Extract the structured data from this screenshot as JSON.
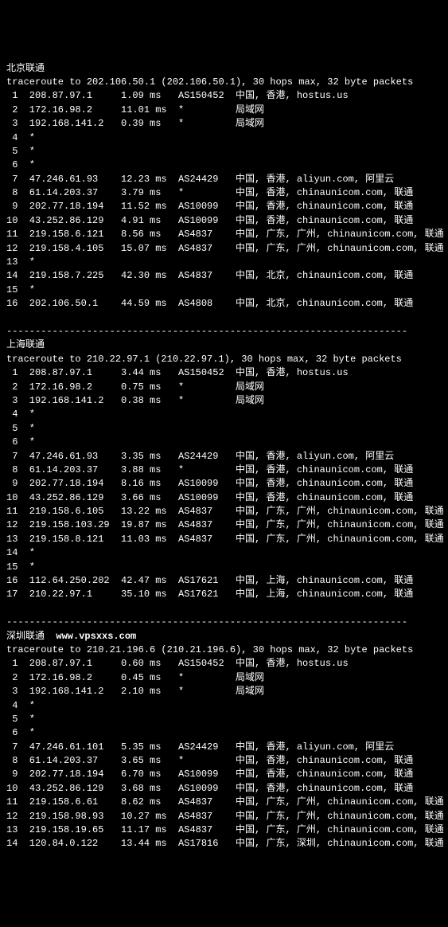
{
  "sections": [
    {
      "title": "北京联通",
      "watermark": "",
      "header": "traceroute to 202.106.50.1 (202.106.50.1), 30 hops max, 32 byte packets",
      "hops": [
        {
          "n": "1",
          "ip": "208.87.97.1",
          "rtt": "1.09 ms",
          "asn": "AS150452",
          "loc": "中国, 香港, hostus.us"
        },
        {
          "n": "2",
          "ip": "172.16.98.2",
          "rtt": "11.01 ms",
          "asn": "*",
          "loc": "局域网"
        },
        {
          "n": "3",
          "ip": "192.168.141.2",
          "rtt": "0.39 ms",
          "asn": "*",
          "loc": "局域网"
        },
        {
          "n": "4",
          "ip": "*",
          "rtt": "",
          "asn": "",
          "loc": ""
        },
        {
          "n": "5",
          "ip": "*",
          "rtt": "",
          "asn": "",
          "loc": ""
        },
        {
          "n": "6",
          "ip": "*",
          "rtt": "",
          "asn": "",
          "loc": ""
        },
        {
          "n": "7",
          "ip": "47.246.61.93",
          "rtt": "12.23 ms",
          "asn": "AS24429",
          "loc": "中国, 香港, aliyun.com, 阿里云"
        },
        {
          "n": "8",
          "ip": "61.14.203.37",
          "rtt": "3.79 ms",
          "asn": "*",
          "loc": "中国, 香港, chinaunicom.com, 联通"
        },
        {
          "n": "9",
          "ip": "202.77.18.194",
          "rtt": "11.52 ms",
          "asn": "AS10099",
          "loc": "中国, 香港, chinaunicom.com, 联通"
        },
        {
          "n": "10",
          "ip": "43.252.86.129",
          "rtt": "4.91 ms",
          "asn": "AS10099",
          "loc": "中国, 香港, chinaunicom.com, 联通"
        },
        {
          "n": "11",
          "ip": "219.158.6.121",
          "rtt": "8.56 ms",
          "asn": "AS4837",
          "loc": "中国, 广东, 广州, chinaunicom.com, 联通"
        },
        {
          "n": "12",
          "ip": "219.158.4.105",
          "rtt": "15.07 ms",
          "asn": "AS4837",
          "loc": "中国, 广东, 广州, chinaunicom.com, 联通"
        },
        {
          "n": "13",
          "ip": "*",
          "rtt": "",
          "asn": "",
          "loc": ""
        },
        {
          "n": "14",
          "ip": "219.158.7.225",
          "rtt": "42.30 ms",
          "asn": "AS4837",
          "loc": "中国, 北京, chinaunicom.com, 联通"
        },
        {
          "n": "15",
          "ip": "*",
          "rtt": "",
          "asn": "",
          "loc": ""
        },
        {
          "n": "16",
          "ip": "202.106.50.1",
          "rtt": "44.59 ms",
          "asn": "AS4808",
          "loc": "中国, 北京, chinaunicom.com, 联通"
        }
      ]
    },
    {
      "title": "上海联通",
      "watermark": "",
      "header": "traceroute to 210.22.97.1 (210.22.97.1), 30 hops max, 32 byte packets",
      "hops": [
        {
          "n": "1",
          "ip": "208.87.97.1",
          "rtt": "3.44 ms",
          "asn": "AS150452",
          "loc": "中国, 香港, hostus.us"
        },
        {
          "n": "2",
          "ip": "172.16.98.2",
          "rtt": "0.75 ms",
          "asn": "*",
          "loc": "局域网"
        },
        {
          "n": "3",
          "ip": "192.168.141.2",
          "rtt": "0.38 ms",
          "asn": "*",
          "loc": "局域网"
        },
        {
          "n": "4",
          "ip": "*",
          "rtt": "",
          "asn": "",
          "loc": ""
        },
        {
          "n": "5",
          "ip": "*",
          "rtt": "",
          "asn": "",
          "loc": ""
        },
        {
          "n": "6",
          "ip": "*",
          "rtt": "",
          "asn": "",
          "loc": ""
        },
        {
          "n": "7",
          "ip": "47.246.61.93",
          "rtt": "3.35 ms",
          "asn": "AS24429",
          "loc": "中国, 香港, aliyun.com, 阿里云"
        },
        {
          "n": "8",
          "ip": "61.14.203.37",
          "rtt": "3.88 ms",
          "asn": "*",
          "loc": "中国, 香港, chinaunicom.com, 联通"
        },
        {
          "n": "9",
          "ip": "202.77.18.194",
          "rtt": "8.16 ms",
          "asn": "AS10099",
          "loc": "中国, 香港, chinaunicom.com, 联通"
        },
        {
          "n": "10",
          "ip": "43.252.86.129",
          "rtt": "3.66 ms",
          "asn": "AS10099",
          "loc": "中国, 香港, chinaunicom.com, 联通"
        },
        {
          "n": "11",
          "ip": "219.158.6.105",
          "rtt": "13.22 ms",
          "asn": "AS4837",
          "loc": "中国, 广东, 广州, chinaunicom.com, 联通"
        },
        {
          "n": "12",
          "ip": "219.158.103.29",
          "rtt": "19.87 ms",
          "asn": "AS4837",
          "loc": "中国, 广东, 广州, chinaunicom.com, 联通"
        },
        {
          "n": "13",
          "ip": "219.158.8.121",
          "rtt": "11.03 ms",
          "asn": "AS4837",
          "loc": "中国, 广东, 广州, chinaunicom.com, 联通"
        },
        {
          "n": "14",
          "ip": "*",
          "rtt": "",
          "asn": "",
          "loc": ""
        },
        {
          "n": "15",
          "ip": "*",
          "rtt": "",
          "asn": "",
          "loc": ""
        },
        {
          "n": "16",
          "ip": "112.64.250.202",
          "rtt": "42.47 ms",
          "asn": "AS17621",
          "loc": "中国, 上海, chinaunicom.com, 联通"
        },
        {
          "n": "17",
          "ip": "210.22.97.1",
          "rtt": "35.10 ms",
          "asn": "AS17621",
          "loc": "中国, 上海, chinaunicom.com, 联通"
        }
      ]
    },
    {
      "title": "深圳联通",
      "watermark": "www.vpsxxs.com",
      "header": "traceroute to 210.21.196.6 (210.21.196.6), 30 hops max, 32 byte packets",
      "hops": [
        {
          "n": "1",
          "ip": "208.87.97.1",
          "rtt": "0.60 ms",
          "asn": "AS150452",
          "loc": "中国, 香港, hostus.us"
        },
        {
          "n": "2",
          "ip": "172.16.98.2",
          "rtt": "0.45 ms",
          "asn": "*",
          "loc": "局域网"
        },
        {
          "n": "3",
          "ip": "192.168.141.2",
          "rtt": "2.10 ms",
          "asn": "*",
          "loc": "局域网"
        },
        {
          "n": "4",
          "ip": "*",
          "rtt": "",
          "asn": "",
          "loc": ""
        },
        {
          "n": "5",
          "ip": "*",
          "rtt": "",
          "asn": "",
          "loc": ""
        },
        {
          "n": "6",
          "ip": "*",
          "rtt": "",
          "asn": "",
          "loc": ""
        },
        {
          "n": "7",
          "ip": "47.246.61.101",
          "rtt": "5.35 ms",
          "asn": "AS24429",
          "loc": "中国, 香港, aliyun.com, 阿里云"
        },
        {
          "n": "8",
          "ip": "61.14.203.37",
          "rtt": "3.65 ms",
          "asn": "*",
          "loc": "中国, 香港, chinaunicom.com, 联通"
        },
        {
          "n": "9",
          "ip": "202.77.18.194",
          "rtt": "6.70 ms",
          "asn": "AS10099",
          "loc": "中国, 香港, chinaunicom.com, 联通"
        },
        {
          "n": "10",
          "ip": "43.252.86.129",
          "rtt": "3.68 ms",
          "asn": "AS10099",
          "loc": "中国, 香港, chinaunicom.com, 联通"
        },
        {
          "n": "11",
          "ip": "219.158.6.61",
          "rtt": "8.62 ms",
          "asn": "AS4837",
          "loc": "中国, 广东, 广州, chinaunicom.com, 联通"
        },
        {
          "n": "12",
          "ip": "219.158.98.93",
          "rtt": "10.27 ms",
          "asn": "AS4837",
          "loc": "中国, 广东, 广州, chinaunicom.com, 联通"
        },
        {
          "n": "13",
          "ip": "219.158.19.65",
          "rtt": "11.17 ms",
          "asn": "AS4837",
          "loc": "中国, 广东, 广州, chinaunicom.com, 联通"
        },
        {
          "n": "14",
          "ip": "120.84.0.122",
          "rtt": "13.44 ms",
          "asn": "AS17816",
          "loc": "中国, 广东, 深圳, chinaunicom.com, 联通"
        }
      ]
    }
  ],
  "separator": "----------------------------------------------------------------------"
}
